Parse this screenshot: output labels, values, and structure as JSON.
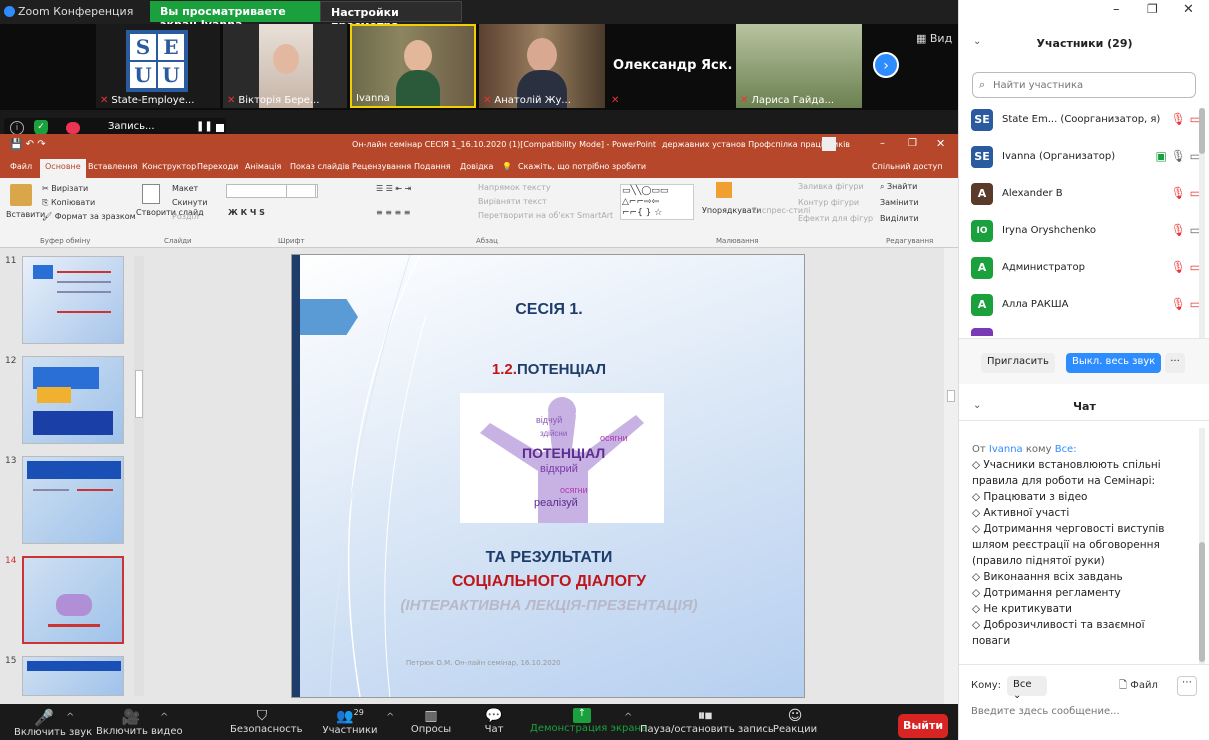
{
  "window": {
    "title": "Zoom Конференция"
  },
  "share": {
    "viewing_label": "Вы просматриваете экран Ivanna",
    "settings_label": "Настройки просмотра ⌄"
  },
  "video_strip": {
    "tiles": [
      {
        "name": "State-Employe..."
      },
      {
        "name": "Вікторія Бере..."
      },
      {
        "name": "Ivanna"
      },
      {
        "name": "Анатолій Жу..."
      },
      {
        "name": "Олександр Яск..."
      },
      {
        "name": "Лариса Гайда..."
      }
    ],
    "grid_label": "Вид"
  },
  "recording": {
    "label": "Запись..."
  },
  "ppt": {
    "title": "Он-лайн семінар СЕСІЯ 1_16.10.2020 (1)[Compatibility Mode] - PowerPoint",
    "title_right": "державних установ Профспілка працівників",
    "tabs": [
      "Файл",
      "Основне",
      "Вставлення",
      "Конструктор",
      "Переходи",
      "Анімація",
      "Показ слайдів",
      "Рецензування",
      "Подання",
      "Довідка"
    ],
    "tell_me": "Скажіть, що потрібно зробити",
    "share": "Спільний доступ",
    "ribbon": {
      "paste": "Вставити",
      "cut": "Вирізати",
      "copy": "Копіювати",
      "format_painter": "Формат за зразком",
      "new_slide": "Створити слайд",
      "layout": "Макет",
      "reset": "Скинути",
      "section": "Розділ",
      "text_direction": "Напрямок тексту",
      "align_text": "Вирівняти текст",
      "smartart": "Перетворити на об'єкт SmartArt",
      "arrange": "Упорядкувати",
      "quick_styles": "Експрес-стилі",
      "shape_fill": "Заливка фігури",
      "shape_outline": "Контур фігури",
      "shape_effects": "Ефекти для фігур",
      "find": "Знайти",
      "replace": "Замінити",
      "select": "Виділити",
      "groups": [
        "Буфер обміну",
        "Слайди",
        "Шрифт",
        "Абзац",
        "Малювання",
        "Редагування"
      ]
    },
    "thumb_numbers": [
      "11",
      "12",
      "13",
      "14",
      "15"
    ],
    "slide": {
      "session": "СЕСІЯ 1.",
      "num": "1.2.",
      "potential": "ПОТЕНЦІАЛ",
      "cloud_words": [
        "ПОТЕНЦІАЛ",
        "відкрий",
        "реалізуй",
        "осягни",
        "здійсни",
        "відчуй",
        "осягни"
      ],
      "line1": "ТА РЕЗУЛЬТАТИ",
      "line2": "СОЦІАЛЬНОГО ДІАЛОГУ",
      "line3": "(ІНТЕРАКТИВНА ЛЕКЦІЯ-ПРЕЗЕНТАЦІЯ)",
      "footer": "Петрюк О.М. Он-лайн семінар, 16.10.2020"
    }
  },
  "bottom": {
    "mic": "Включить звук",
    "video": "Включить видео",
    "security": "Безопасность",
    "participants": "Участники",
    "participants_count": "29",
    "polls": "Опросы",
    "chat": "Чат",
    "share": "Демонстрация экрана",
    "record": "Пауза/остановить запись",
    "reactions": "Реакции",
    "exit": "Выйти"
  },
  "participants": {
    "title": "Участники (29)",
    "search_placeholder": "Найти участника",
    "list": [
      {
        "name": "State Em... (Соорганизатор, я)",
        "avatar": "SE",
        "color": "#2a5b9f"
      },
      {
        "name": "Ivanna (Организатор)",
        "avatar": "SE",
        "color": "#2a5b9f"
      },
      {
        "name": "Alexander B",
        "avatar": "A",
        "color": "#5a3a2a"
      },
      {
        "name": "Iryna Oryshchenko",
        "avatar": "IO",
        "color": "#1aa13e"
      },
      {
        "name": "Администратор",
        "avatar": "A",
        "color": "#1aa13e"
      },
      {
        "name": "Алла РАКША",
        "avatar": "A",
        "color": "#1aa13e"
      }
    ],
    "invite": "Пригласить",
    "mute_all": "Выкл. весь звук",
    "more": "..."
  },
  "chat": {
    "title": "Чат",
    "from_prefix": "От",
    "from_name": "Ivanna",
    "to_word": "кому",
    "to_name": "Все:",
    "lines": [
      "◇        Учасники встановлюють спільні",
      "правила для роботи на Семінарі:",
      "◇        Працювати з  відео",
      "◇         Активної участі",
      "◇        Дотримання черговості виступів",
      "шляом  реєстрації на обговорення",
      "(правило піднятої руки)",
      "◇        Виконаання всіх завдань",
      "◇        Дотримання регламенту",
      "◇        Не критикувати",
      "◇        Доброзичливості та взаємної",
      "поваги"
    ],
    "to_label": "Кому:",
    "to_select": "Все",
    "file": "Файл",
    "input_placeholder": "Введите здесь сообщение..."
  }
}
